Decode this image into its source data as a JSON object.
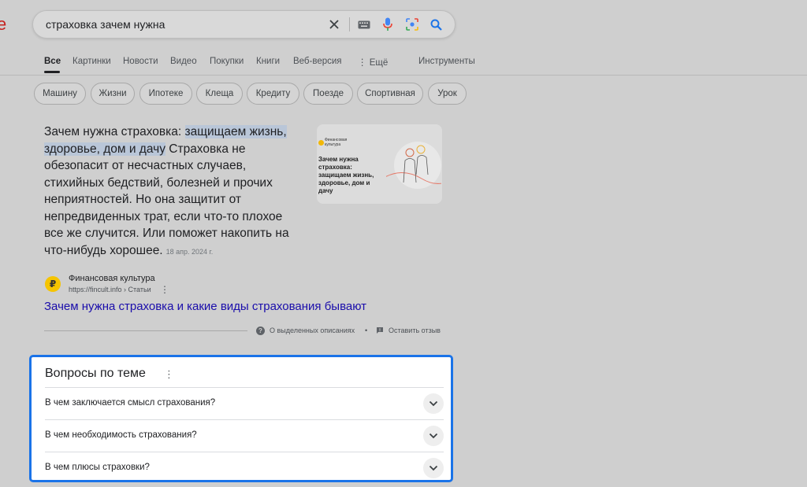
{
  "search": {
    "query": "страховка зачем нужна"
  },
  "tabs": [
    "Все",
    "Картинки",
    "Новости",
    "Видео",
    "Покупки",
    "Книги",
    "Веб-версия",
    "Ещё",
    "Инструменты"
  ],
  "chips": [
    "Машину",
    "Жизни",
    "Ипотеке",
    "Клеща",
    "Кредиту",
    "Поезде",
    "Спортивная",
    "Урок"
  ],
  "snippet": {
    "lead": "Зачем нужна страховка: ",
    "highlight1": "защищаем жизнь,",
    "highlight2": "здоровье, дом и дачу",
    "rest": " Страховка не обезопасит от несчастных случаев, стихийных бедствий, болезней и прочих неприятностей. Но она защитит от непредвиденных трат, если что-то плохое все же случится. Или поможет накопить на что-нибудь хорошее.",
    "date": "18 апр. 2024 г."
  },
  "thumbnail": {
    "brand_line1": "Финансовая",
    "brand_line2": "культура",
    "title": "Зачем нужна страховка: защищаем жизнь, здоровье, дом и дачу"
  },
  "source": {
    "icon_letter": "₽",
    "name": "Финансовая культура",
    "url": "https://fincult.info › Статьи",
    "link": "Зачем нужна страховка и какие виды страхования бывают"
  },
  "feedback": {
    "about": "О выделенных описаниях",
    "bullet": "•",
    "leave": "Оставить отзыв"
  },
  "paa": {
    "title": "Вопросы по теме",
    "questions": [
      "В чем заключается смысл страхования?",
      "В чем необходимость страхования?",
      "В чем плюсы страховки?"
    ]
  },
  "colors": {
    "highlight_border": "#1a73e8",
    "link": "#1a0dab",
    "mic_blue": "#4285f4",
    "mic_red": "#ea4335"
  }
}
